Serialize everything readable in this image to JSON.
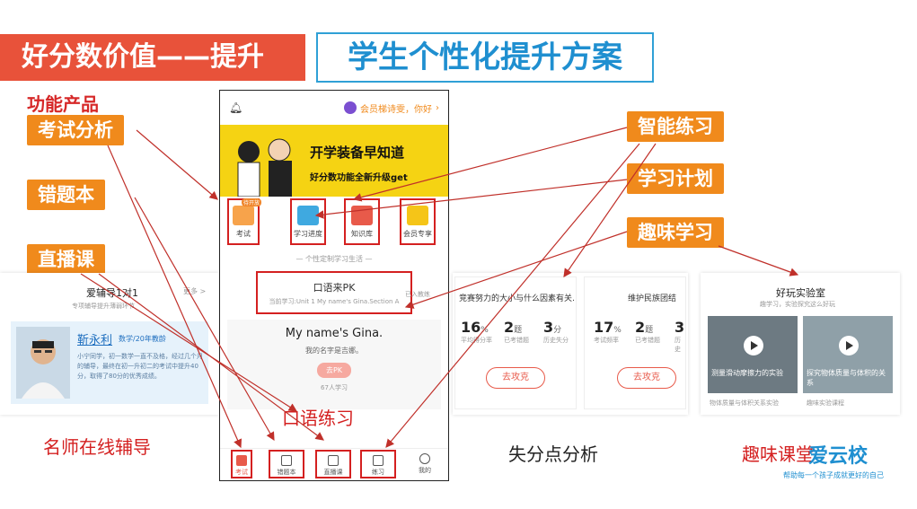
{
  "header": {
    "left_title": "好分数价值——提升",
    "right_title": "学生个性化提升方案"
  },
  "left_labels": {
    "func_products": "功能产品",
    "exam_analysis": "考试分析",
    "wrong_book": "错题本",
    "live_course": "直播课"
  },
  "right_labels": {
    "smart_practice": "智能练习",
    "study_plan": "学习计划",
    "fun_learning": "趣味学习"
  },
  "phone": {
    "user_greeting": "会员梯诗雯，你好",
    "banner_line1": "开学装备早知道",
    "banner_line2": "好分数功能全新升级get",
    "functions": [
      {
        "label": "考试",
        "badge": "待开放"
      },
      {
        "label": "学习进度"
      },
      {
        "label": "知识库"
      },
      {
        "label": "会员专享"
      }
    ],
    "section_title": "— 个性定制学习生活 —",
    "oral_pk": {
      "title": "口语来PK",
      "side": "已入教练",
      "sub": "当前学习:Unit 1 My name's Gina.Section A"
    },
    "sentence": {
      "text": "My name's Gina.",
      "meaning": "我的名字是吉娜。",
      "button": "去PK",
      "count": "67人学习"
    },
    "bottom_nav": [
      "考试",
      "错题本",
      "直播课",
      "练习",
      "我的"
    ]
  },
  "teacher_panel": {
    "title": "爱辅导1对1",
    "more": "更多 >",
    "subtitle": "专项辅导提升薄弱环节",
    "name": "靳永利",
    "meta": "数学/20年教龄",
    "desc": "小宁同学，初一数学一直不及格，经过几个月的辅导，最终在初一升初二的考试中提升40分，取得了80分的优秀成绩。"
  },
  "loss_panel": {
    "card1": {
      "title": "竞赛努力的大小与什么因素有关…",
      "stats": [
        {
          "num": "16",
          "unit": "%",
          "label": "平均得分率"
        },
        {
          "num": "2",
          "unit": "题",
          "label": "已考错题"
        },
        {
          "num": "3",
          "unit": "分",
          "label": "历史失分"
        }
      ],
      "button": "去攻克"
    },
    "card2": {
      "title": "维护民族团结",
      "stats": [
        {
          "num": "17",
          "unit": "%",
          "label": "考试频率"
        },
        {
          "num": "2",
          "unit": "题",
          "label": "已考错题"
        },
        {
          "num": "3",
          "unit": "",
          "label": "历史"
        }
      ],
      "button": "去攻克"
    }
  },
  "lab_panel": {
    "title": "好玩实验室",
    "subtitle": "趣学习，实验探究这么好玩",
    "video1": "测量滑动摩擦力的实验",
    "video2": "探究物体质量与体积的关系",
    "foot1": "物体质量与体积关系实验",
    "foot2": "趣味实验课程"
  },
  "captions": {
    "oral": "口语练习",
    "teacher": "名师在线辅导",
    "loss": "失分点分析",
    "fun_class": "趣味课堂",
    "logo": "爱云校",
    "logo_sub": "帮助每一个孩子成就更好的自己"
  },
  "colors": {
    "red": "#e8523a",
    "blue": "#1f8fd0",
    "orange": "#f08a1c",
    "box_red": "#d42020"
  }
}
